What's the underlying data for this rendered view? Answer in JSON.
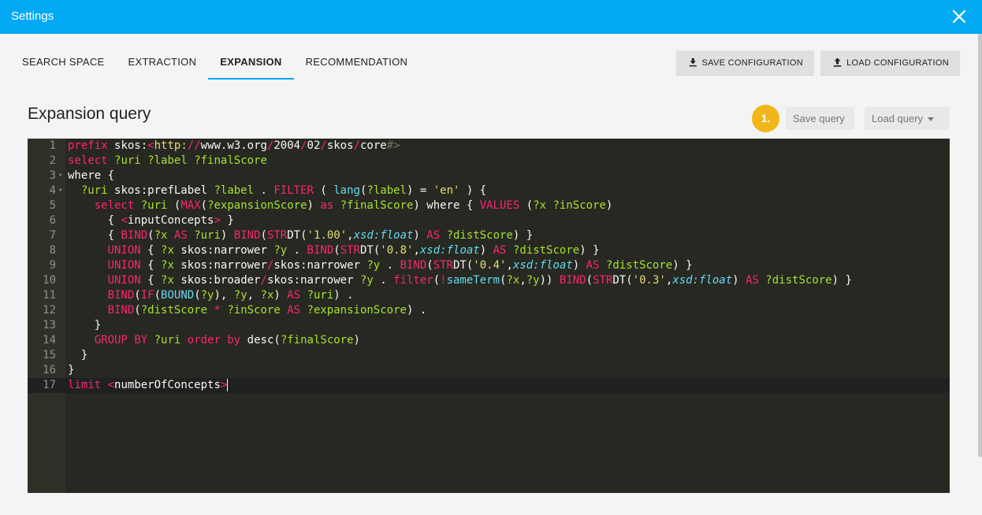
{
  "dialog": {
    "title": "Settings",
    "close_icon": "close-icon"
  },
  "tabs": [
    {
      "label": "SEARCH SPACE",
      "active": false
    },
    {
      "label": "EXTRACTION",
      "active": false
    },
    {
      "label": "EXPANSION",
      "active": true
    },
    {
      "label": "RECOMMENDATION",
      "active": false
    }
  ],
  "toolbar": {
    "save_config_label": "SAVE CONFIGURATION",
    "save_config_icon": "download-icon",
    "load_config_label": "LOAD CONFIGURATION",
    "load_config_icon": "upload-icon"
  },
  "section": {
    "title": "Expansion query",
    "step_badge": "1.",
    "save_query_label": "Save query",
    "load_query_label": "Load query"
  },
  "colors": {
    "accent": "#03a9f4",
    "badge": "#f2b619",
    "editor_bg": "#272822"
  },
  "editor": {
    "active_line": 17,
    "lines": [
      {
        "n": "1",
        "fold": false,
        "code": "prefix skos:<http://www.w3.org/2004/02/skos/core#>"
      },
      {
        "n": "2",
        "fold": false,
        "code": "select ?uri ?label ?finalScore"
      },
      {
        "n": "3",
        "fold": true,
        "code": "where {"
      },
      {
        "n": "4",
        "fold": true,
        "code": "  ?uri skos:prefLabel ?label . FILTER ( lang(?label) = 'en' ) {"
      },
      {
        "n": "5",
        "fold": false,
        "code": "    select ?uri (MAX(?expansionScore) as ?finalScore) where { VALUES (?x ?inScore)"
      },
      {
        "n": "6",
        "fold": false,
        "code": "      { <inputConcepts> }"
      },
      {
        "n": "7",
        "fold": false,
        "code": "      { BIND(?x AS ?uri) BIND(STRDT('1.00',xsd:float) AS ?distScore) }"
      },
      {
        "n": "8",
        "fold": false,
        "code": "      UNION { ?x skos:narrower ?y . BIND(STRDT('0.8',xsd:float) AS ?distScore) }"
      },
      {
        "n": "9",
        "fold": false,
        "code": "      UNION { ?x skos:narrower/skos:narrower ?y . BIND(STRDT('0.4',xsd:float) AS ?distScore) }"
      },
      {
        "n": "10",
        "fold": false,
        "code": "      UNION { ?x skos:broader/skos:narrower ?y . filter(!sameTerm(?x,?y)) BIND(STRDT('0.3',xsd:float) AS ?distScore) }"
      },
      {
        "n": "11",
        "fold": false,
        "code": "      BIND(IF(BOUND(?y), ?y, ?x) AS ?uri) ."
      },
      {
        "n": "12",
        "fold": false,
        "code": "      BIND(?distScore * ?inScore AS ?expansionScore) ."
      },
      {
        "n": "13",
        "fold": false,
        "code": "    }"
      },
      {
        "n": "14",
        "fold": false,
        "code": "    GROUP BY ?uri order by desc(?finalScore)"
      },
      {
        "n": "15",
        "fold": false,
        "code": "  }"
      },
      {
        "n": "16",
        "fold": false,
        "code": "}"
      },
      {
        "n": "17",
        "fold": false,
        "code": "limit <numberOfConcepts>"
      }
    ]
  }
}
